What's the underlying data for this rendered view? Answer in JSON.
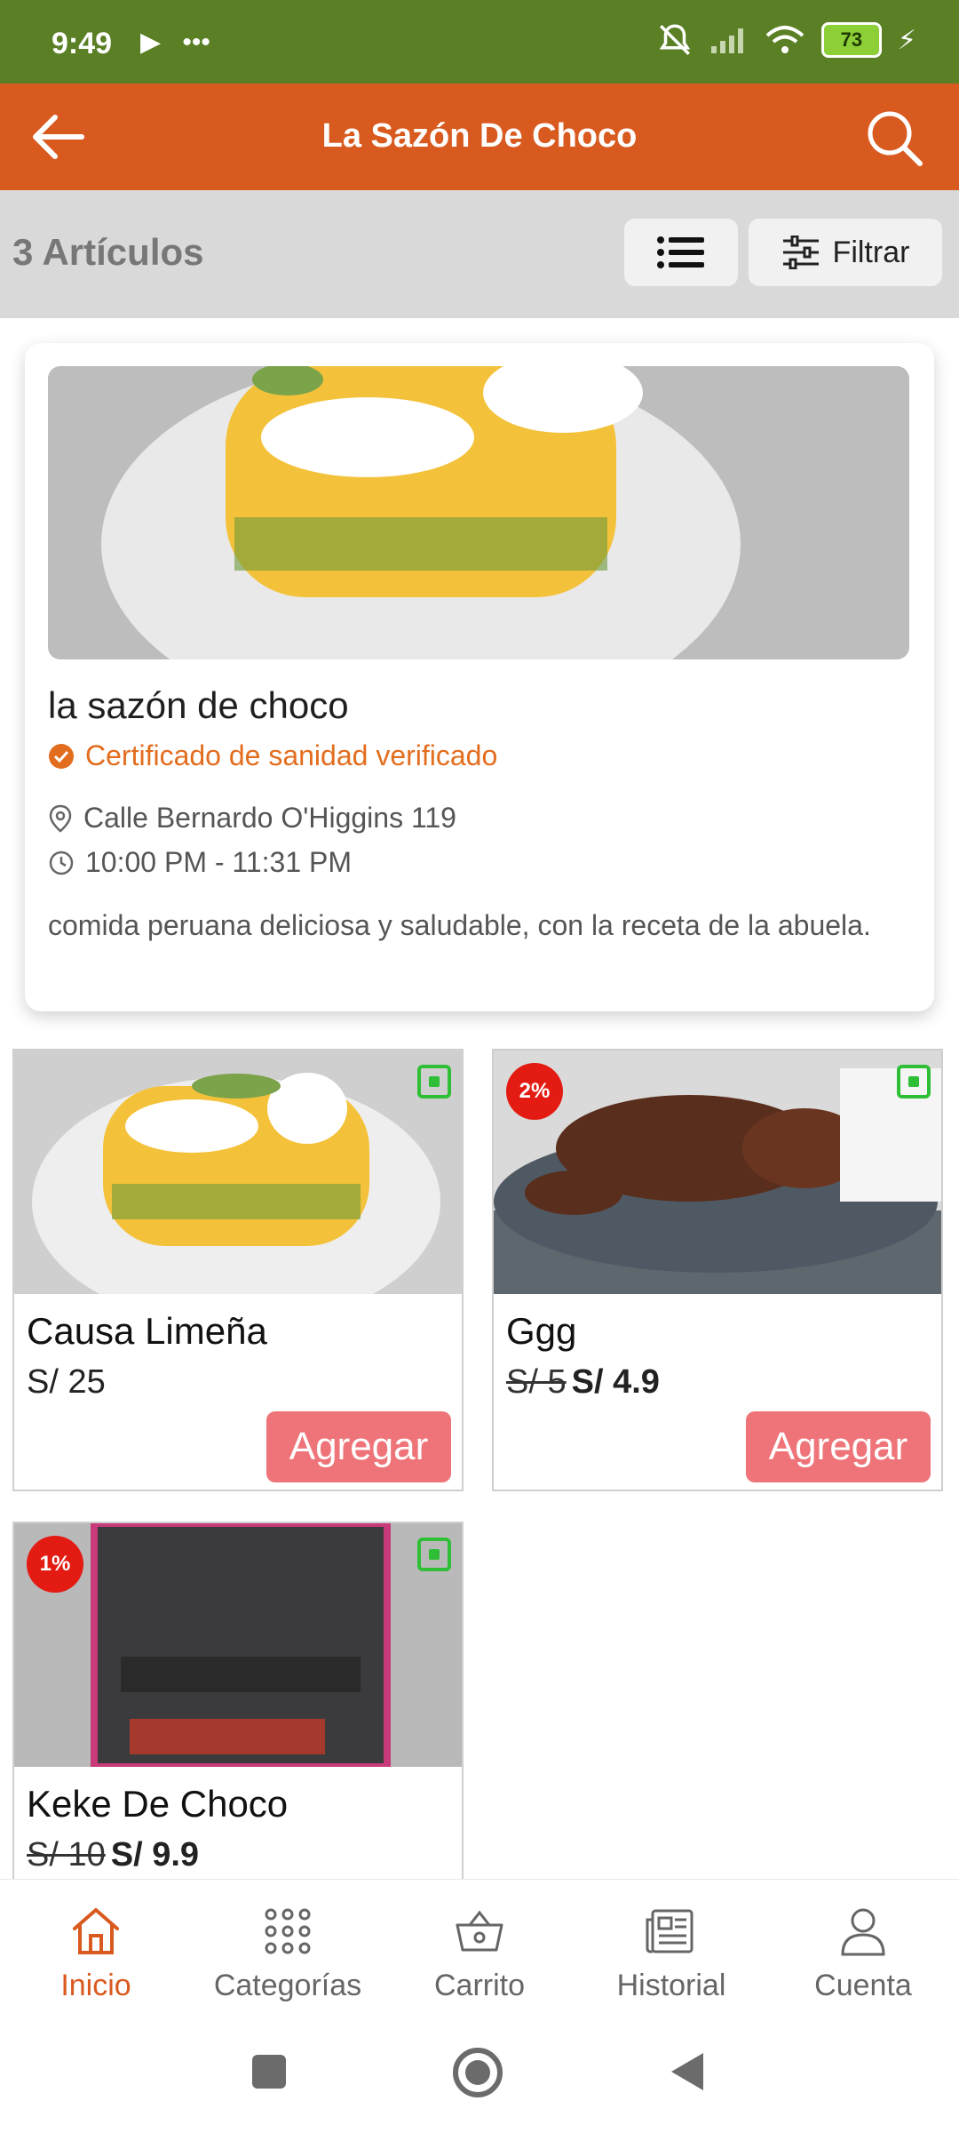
{
  "status_bar": {
    "time": "9:49",
    "battery": "73"
  },
  "app_bar": {
    "title": "La Sazón De Choco"
  },
  "toolbar": {
    "count_label": "3 Artículos",
    "filter_label": "Filtrar"
  },
  "store": {
    "name": "la sazón de choco",
    "certificate": "Certificado de sanidad verificado",
    "address": "Calle Bernardo O'Higgins 119",
    "hours": "10:00 PM - 11:31 PM",
    "description": "comida peruana deliciosa y saludable, con la receta de la abuela."
  },
  "products": [
    {
      "name": "Causa Limeña",
      "price": "S/ 25",
      "add_label": "Agregar"
    },
    {
      "name": "Ggg",
      "old_price": "S/ 5",
      "new_price": "S/ 4.9",
      "discount": "2%",
      "add_label": "Agregar"
    },
    {
      "name": "Keke De Choco",
      "old_price": "S/ 10",
      "new_price": "S/ 9.9",
      "discount": "1%"
    }
  ],
  "bottom_nav": [
    {
      "label": "Inicio",
      "icon": "home-icon",
      "active": true
    },
    {
      "label": "Categorías",
      "icon": "grid-icon"
    },
    {
      "label": "Carrito",
      "icon": "basket-icon"
    },
    {
      "label": "Historial",
      "icon": "history-icon"
    },
    {
      "label": "Cuenta",
      "icon": "account-icon"
    }
  ],
  "colors": {
    "status_bar": "#5a7f24",
    "app_bar": "#d95a1f",
    "accent": "#e36d1e",
    "add_button": "#ee7479",
    "discount_badge": "#e31b13"
  }
}
